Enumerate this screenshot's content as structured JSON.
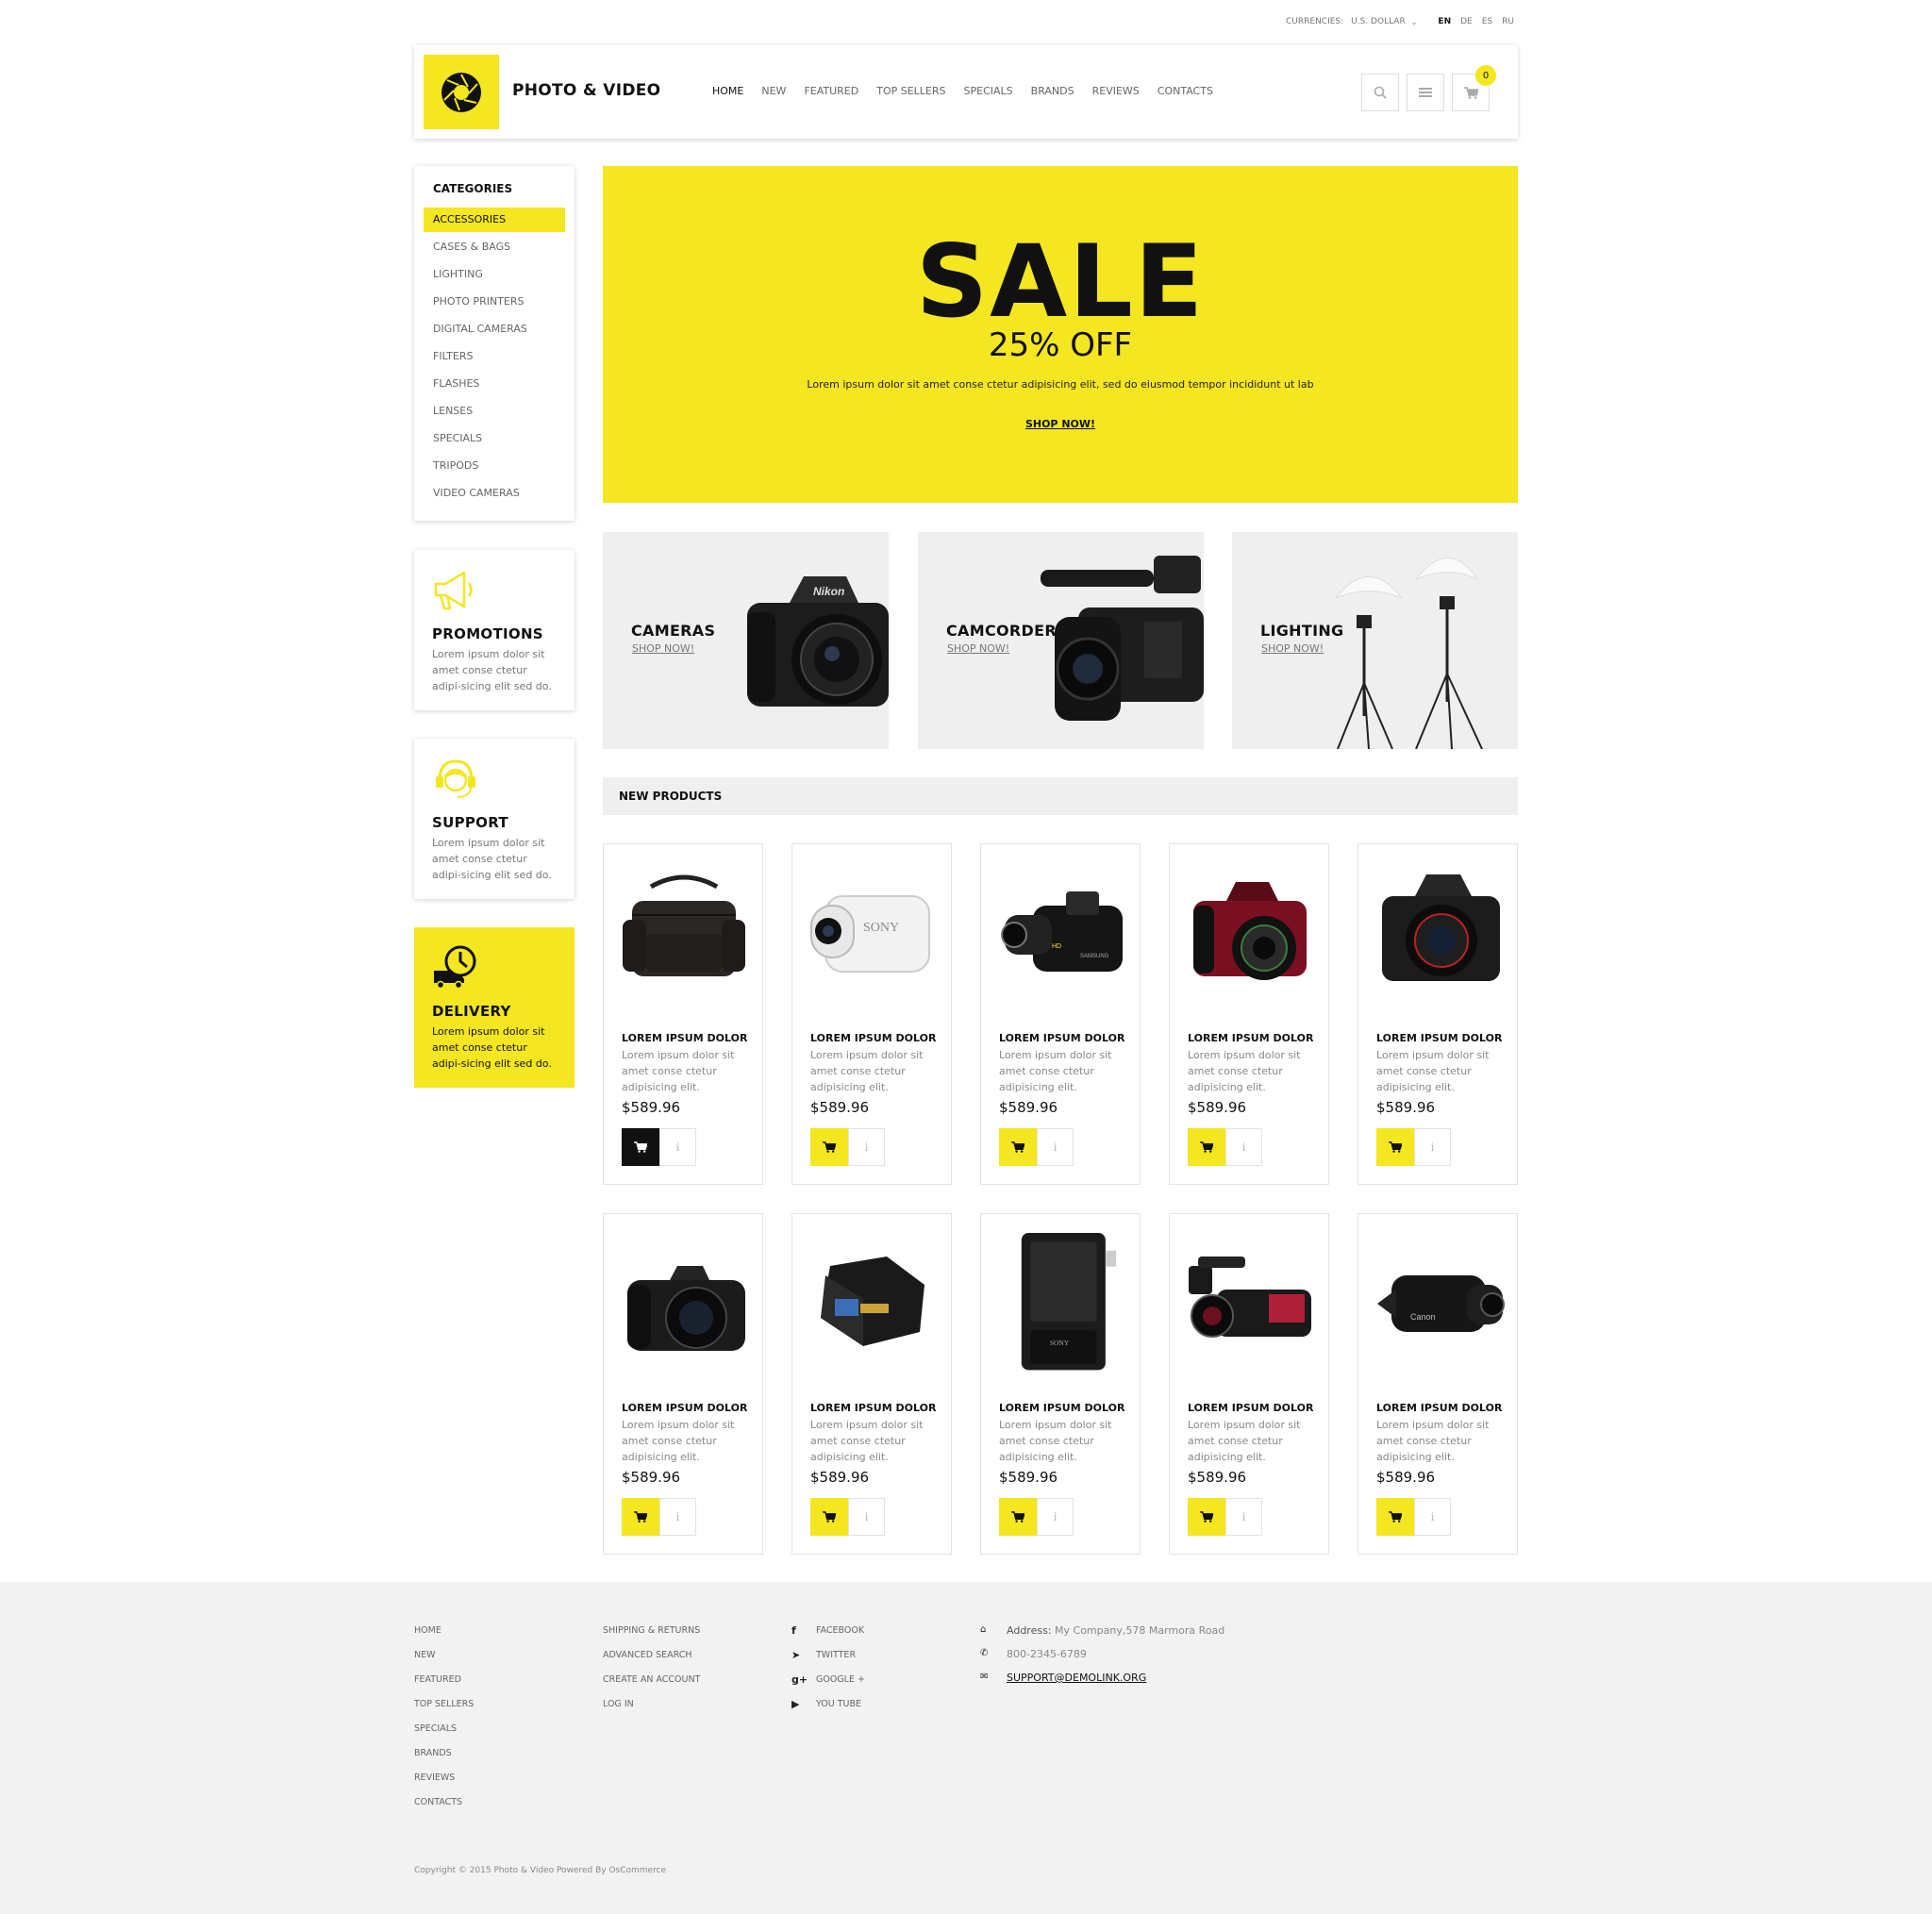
{
  "topbar": {
    "currencies_label": "CURRENCIES:",
    "currency_value": "U.S. DOLLAR",
    "languages": [
      "EN",
      "DE",
      "ES",
      "RU"
    ],
    "active_language": "EN"
  },
  "header": {
    "logo_text": "PHOTO & VIDEO",
    "nav": [
      "HOME",
      "NEW",
      "FEATURED",
      "TOP SELLERS",
      "SPECIALS",
      "BRANDS",
      "REVIEWS",
      "CONTACTS"
    ],
    "cart_count": "0",
    "icons": [
      "search-icon",
      "menu-icon",
      "cart-icon"
    ]
  },
  "sidebar": {
    "categories_title": "CATEGORIES",
    "categories": [
      "ACCESSORIES",
      "CASES & BAGS",
      "LIGHTING",
      "PHOTO PRINTERS",
      "DIGITAL CAMERAS",
      "FILTERS",
      "FLASHES",
      "LENSES",
      "SPECIALS",
      "TRIPODS",
      "VIDEO CAMERAS"
    ],
    "active_category": "ACCESSORIES",
    "info_boxes": [
      {
        "title": "PROMOTIONS",
        "text": "Lorem ipsum dolor sit amet conse ctetur adipi-sicing elit sed do.",
        "icon": "megaphone-icon"
      },
      {
        "title": "SUPPORT",
        "text": "Lorem ipsum dolor sit amet conse ctetur adipi-sicing elit sed do.",
        "icon": "headset-icon"
      },
      {
        "title": "DELIVERY",
        "text": "Lorem ipsum dolor sit amet conse ctetur adipi-sicing elit sed do.",
        "icon": "delivery-truck-icon"
      }
    ]
  },
  "banner": {
    "headline": "SALE",
    "subheadline": "25% OFF",
    "description": "Lorem ipsum dolor sit amet conse ctetur adipisicing elit, sed do eiusmod tempor incididunt ut lab",
    "cta": "SHOP NOW!"
  },
  "tiles": [
    {
      "title": "CAMERAS",
      "cta": "SHOP NOW!",
      "image": "dslr-camera-image"
    },
    {
      "title": "CAMCORDERS",
      "cta": "SHOP NOW!",
      "image": "camcorder-image"
    },
    {
      "title": "LIGHTING",
      "cta": "SHOP NOW!",
      "image": "studio-umbrella-lights-image"
    }
  ],
  "new_products": {
    "title": "NEW PRODUCTS",
    "items": [
      {
        "name": "LOREM IPSUM DOLOR",
        "desc": "Lorem ipsum dolor sit amet conse ctetur adipisicing elit.",
        "price": "$589.96",
        "image": "camera-bag-image"
      },
      {
        "name": "LOREM IPSUM DOLOR",
        "desc": "Lorem ipsum dolor sit amet conse ctetur adipisicing elit.",
        "price": "$589.96",
        "image": "action-camera-image"
      },
      {
        "name": "LOREM IPSUM DOLOR",
        "desc": "Lorem ipsum dolor sit amet conse ctetur adipisicing elit.",
        "price": "$589.96",
        "image": "handycam-image"
      },
      {
        "name": "LOREM IPSUM DOLOR",
        "desc": "Lorem ipsum dolor sit amet conse ctetur adipisicing elit.",
        "price": "$589.96",
        "image": "red-dslr-image"
      },
      {
        "name": "LOREM IPSUM DOLOR",
        "desc": "Lorem ipsum dolor sit amet conse ctetur adipisicing elit.",
        "price": "$589.96",
        "image": "dslr-image"
      },
      {
        "name": "LOREM IPSUM DOLOR",
        "desc": "Lorem ipsum dolor sit amet conse ctetur adipisicing elit.",
        "price": "$589.96",
        "image": "bridge-camera-image"
      },
      {
        "name": "LOREM IPSUM DOLOR",
        "desc": "Lorem ipsum dolor sit amet conse ctetur adipisicing elit.",
        "price": "$589.96",
        "image": "battery-image"
      },
      {
        "name": "LOREM IPSUM DOLOR",
        "desc": "Lorem ipsum dolor sit amet conse ctetur adipisicing elit.",
        "price": "$589.96",
        "image": "battery-charger-image"
      },
      {
        "name": "LOREM IPSUM DOLOR",
        "desc": "Lorem ipsum dolor sit amet conse ctetur adipisicing elit.",
        "price": "$589.96",
        "image": "pro-camcorder-image"
      },
      {
        "name": "LOREM IPSUM DOLOR",
        "desc": "Lorem ipsum dolor sit amet conse ctetur adipisicing elit.",
        "price": "$589.96",
        "image": "compact-camcorder-image"
      }
    ]
  },
  "footer": {
    "col1": [
      "HOME",
      "NEW",
      "FEATURED",
      "TOP SELLERS",
      "SPECIALS",
      "BRANDS",
      "REVIEWS",
      "CONTACTS"
    ],
    "col2": [
      "SHIPPING & RETURNS",
      "ADVANCED SEARCH",
      "CREATE AN ACCOUNT",
      "LOG IN"
    ],
    "social": [
      {
        "label": "FACEBOOK",
        "icon": "facebook-icon"
      },
      {
        "label": "TWITTER",
        "icon": "twitter-icon"
      },
      {
        "label": "GOOGLE +",
        "icon": "google-plus-icon"
      },
      {
        "label": "YOU TUBE",
        "icon": "youtube-icon"
      }
    ],
    "address_label": "Address:",
    "address_value": "My Company,578 Marmora Road",
    "phone": "800-2345-6789",
    "email": "SUPPORT@DEMOLINK.ORG",
    "copyright": "Copyright © 2015 Photo & Video Powered By OsCommerce"
  },
  "colors": {
    "accent": "#f4e620",
    "dark": "#111111",
    "tile_bg": "#efefef",
    "footer_bg": "#f2f2f2"
  }
}
